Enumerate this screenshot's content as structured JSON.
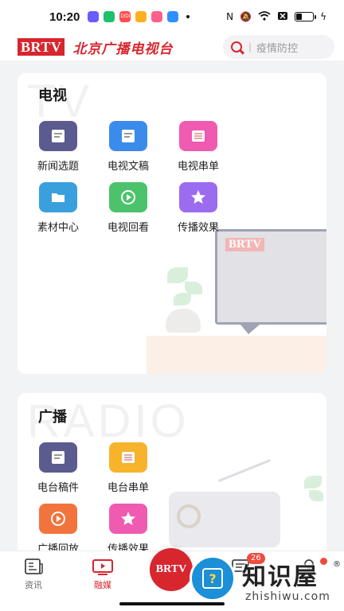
{
  "status_bar": {
    "time": "10:20",
    "app_icons": [
      {
        "name": "app-icon-1",
        "color": "#6a5cff"
      },
      {
        "name": "app-icon-2",
        "color": "#1fbf6b"
      },
      {
        "name": "app-icon-3",
        "color": "#ff4d4f",
        "text": "DIDI"
      },
      {
        "name": "app-icon-4",
        "color": "#ffb020"
      },
      {
        "name": "app-icon-5",
        "color": "#ff5f8a"
      },
      {
        "name": "app-icon-6",
        "color": "#2f8fff"
      }
    ],
    "battery_level": 0.35
  },
  "header": {
    "logo_text": "BRTV",
    "logo_cn": "北京广播电视台",
    "search_placeholder": "疫情防控",
    "search_separator": "|",
    "colors": {
      "brand": "#d7262e"
    }
  },
  "tv_section": {
    "title": "电视",
    "watermark": "TV",
    "tiles": [
      {
        "label": "新闻选题",
        "icon": "doc-icon",
        "color": "#5b5b8f"
      },
      {
        "label": "电视文稿",
        "icon": "doc-icon",
        "color": "#3b8bea"
      },
      {
        "label": "电视串单",
        "icon": "list-icon",
        "color": "#ef5bb0"
      },
      {
        "label": "素材中心",
        "icon": "folder-icon",
        "color": "#39a0dd"
      },
      {
        "label": "电视回看",
        "icon": "replay-icon",
        "color": "#4cc36b"
      },
      {
        "label": "传播效果",
        "icon": "star-icon",
        "color": "#9b6bf0"
      }
    ],
    "illustration_brand": "BRTV"
  },
  "radio_section": {
    "title": "广播",
    "watermark": "RADIO",
    "tiles": [
      {
        "label": "电台稿件",
        "icon": "doc-icon",
        "color": "#5b5b8f"
      },
      {
        "label": "电台串单",
        "icon": "list-icon",
        "color": "#f7b32b"
      },
      {
        "label": "广播回放",
        "icon": "replay-icon",
        "color": "#f2743c"
      },
      {
        "label": "传播效果",
        "icon": "star-icon",
        "color": "#ef5bb0"
      }
    ]
  },
  "bottom_nav": {
    "items": [
      {
        "label": "资讯",
        "icon": "news-icon"
      },
      {
        "label": "融媒",
        "icon": "media-icon",
        "active": true
      }
    ],
    "center_label": "BRTV",
    "message_badge": "26"
  },
  "site_watermark": {
    "title": "知识屋",
    "registered": "®",
    "url": "zhishiwu.com",
    "icon_char": "?"
  }
}
